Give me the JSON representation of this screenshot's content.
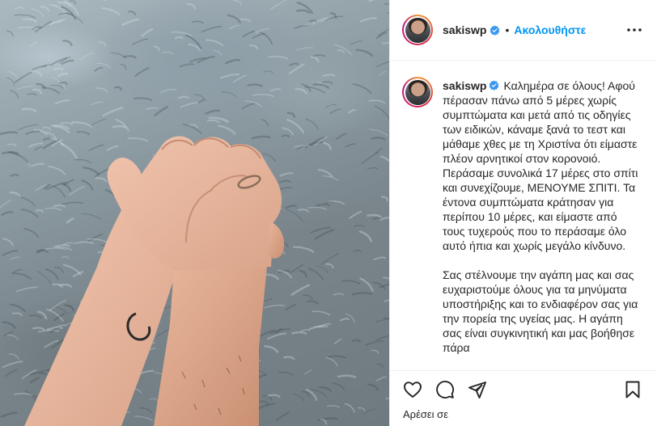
{
  "post": {
    "username": "sakiswp",
    "follow_label": "Ακολουθήστε",
    "separator": "•",
    "caption_paragraph_1": "Καλημέρα σε όλους! Αφού πέρασαν πάνω από 5 μέρες χωρίς συμπτώματα και μετά από τις οδηγίες των ειδικών, κάναμε ξανά το τεστ και μάθαμε χθες με τη Χριστίνα ότι είμαστε πλέον αρνητικοί στον κορονοιό. Περάσαμε συνολικά 17 μέρες στο σπίτι και συνεχίζουμε, ΜΕΝΟΥΜΕ ΣΠΙΤΙ. Τα έντονα συμπτώματα κράτησαν για περίπου 10 μέρες, και είμαστε από τους τυχερούς που το περάσαμε όλο αυτό ήπια και χωρίς μεγάλο κίνδυνο.",
    "caption_paragraph_2": "Σας στέλνουμε την αγάπη μας και σας ευχαριστούμε όλους για τα μηνύματα υποστήριξης και το ενδιαφέρον σας για την πορεία της υγείας μας. Η αγάπη σας είναι συγκινητική και μας βοήθησε πάρα",
    "likes_label": "Αρέσει σε"
  },
  "icons": {
    "verified": "verified-badge-icon",
    "more": "more-options-icon",
    "like": "heart-icon",
    "comment": "comment-icon",
    "share": "share-icon",
    "save": "bookmark-icon"
  },
  "colors": {
    "accent": "#0095f6",
    "text": "#262626",
    "border": "#efefef"
  }
}
